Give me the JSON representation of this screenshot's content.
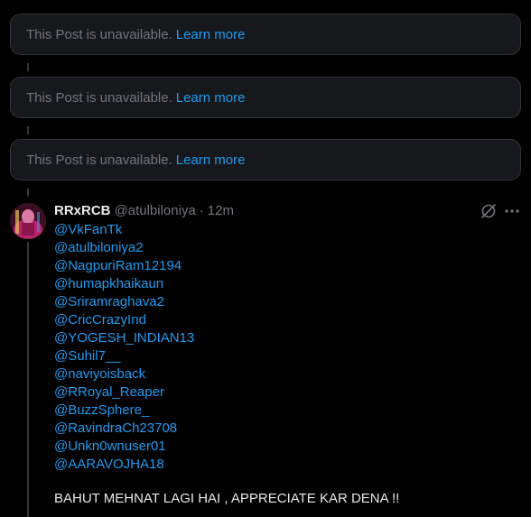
{
  "unavailable_posts": [
    {
      "message": "This Post is unavailable.",
      "link": "Learn more"
    },
    {
      "message": "This Post is unavailable.",
      "link": "Learn more"
    },
    {
      "message": "This Post is unavailable.",
      "link": "Learn more"
    }
  ],
  "post": {
    "display_name": "RRxRCB",
    "handle": "@atulbiloniya",
    "separator": "·",
    "time": "12m",
    "mentions": [
      "@VkFanTk",
      "@atulbiloniya2",
      "@NagpuriRam12194",
      "@humapkhaikaun",
      "@Sriramraghava2",
      "@CricCrazyInd",
      "@YOGESH_INDIAN13",
      "@Suhil7__",
      "@naviyoisback",
      "@RRoyal_Reaper",
      "@BuzzSphere_",
      "@RavindraCh23708",
      "@Unkn0wnuser01",
      "@AARAVOJHA18"
    ],
    "text": "BAHUT MEHNAT LAGI HAI , APPRECIATE KAR DENA !!"
  },
  "icons": {
    "grok": "grok-icon",
    "more": "more-icon",
    "avatar": "avatar"
  },
  "colors": {
    "background": "#000000",
    "card": "#16181c",
    "border": "#2f3336",
    "link": "#1d9bf0",
    "muted": "#71767b",
    "text": "#e7e9ea"
  }
}
